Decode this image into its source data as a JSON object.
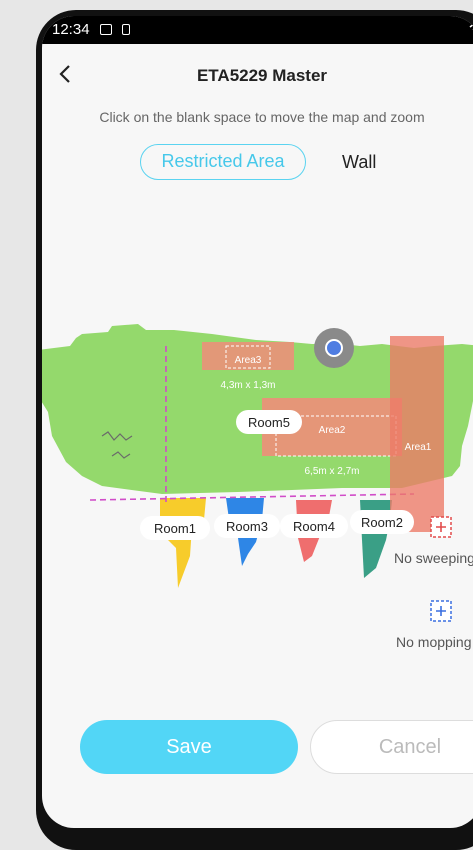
{
  "status_bar": {
    "time": "12:34"
  },
  "header": {
    "title": "ETA5229 Master"
  },
  "hint": "Click on the blank space to move the map and zoom",
  "tabs": [
    {
      "label": "Restricted Area",
      "active": true
    },
    {
      "label": "Wall",
      "active": false
    }
  ],
  "map": {
    "areas": [
      {
        "label": "Area3",
        "size": "4,3m x 1,3m"
      },
      {
        "label": "Area2",
        "size": "6,5m x 2,7m"
      },
      {
        "label": "Area1"
      }
    ],
    "rooms": [
      "Room5",
      "Room1",
      "Room3",
      "Room4",
      "Room2"
    ],
    "colors": {
      "floor": "#94d96c",
      "restricted": "#f08c7a",
      "room1": "#f7cc2b",
      "room3": "#2e86e6",
      "room4": "#ef6e6e",
      "room2": "#3a9f86"
    }
  },
  "tools": {
    "no_sweeping": "No sweeping",
    "no_mopping": "No mopping"
  },
  "actions": {
    "save": "Save",
    "cancel": "Cancel"
  },
  "accent": "#52d6f6"
}
